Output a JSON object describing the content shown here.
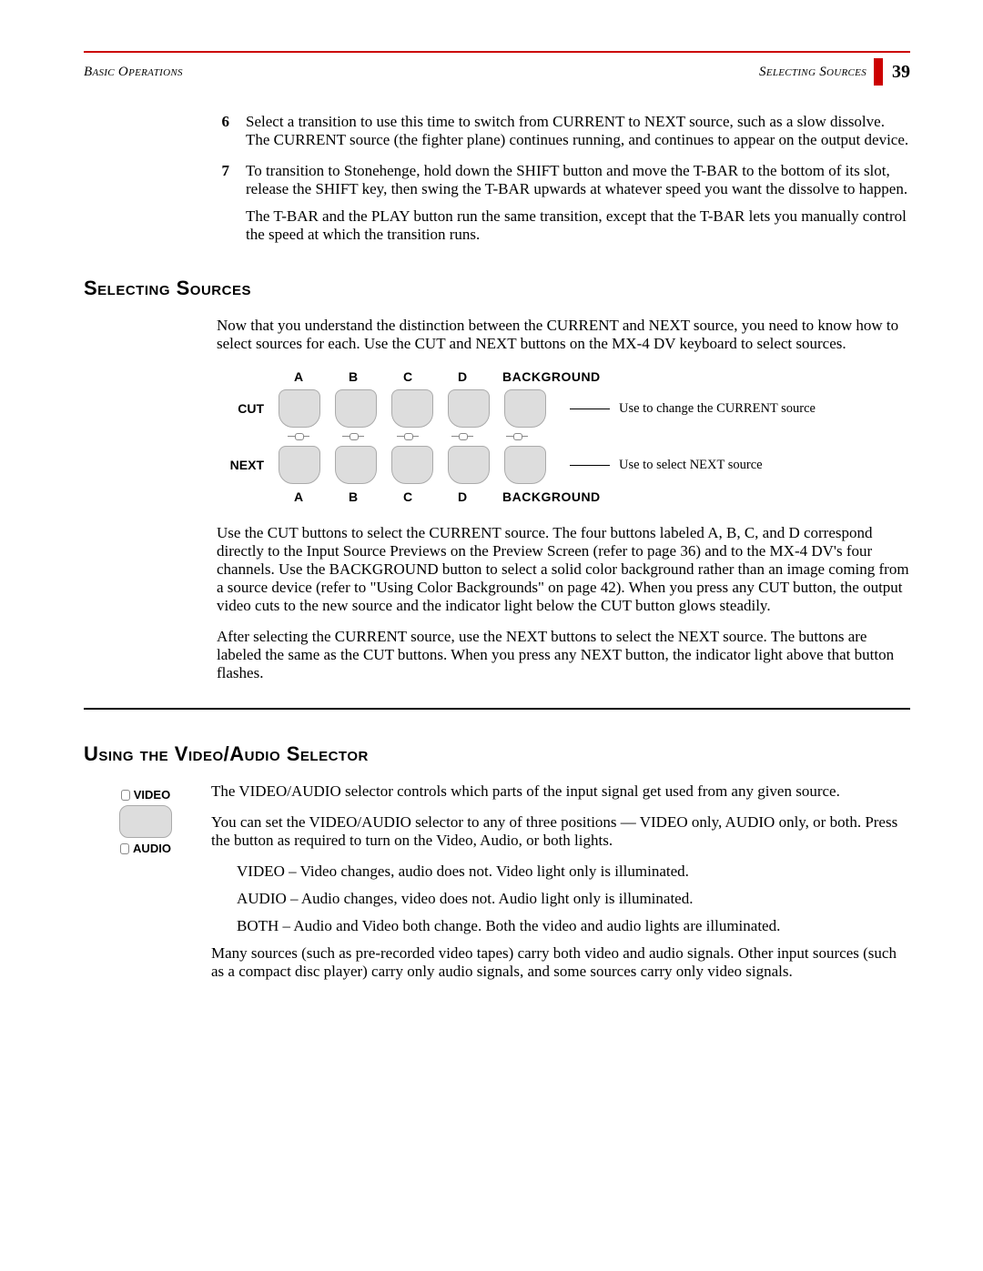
{
  "header": {
    "left": "Basic Operations",
    "right": "Selecting Sources",
    "page": "39"
  },
  "steps": [
    {
      "num": "6",
      "text": "Select a transition to use this time to switch from CURRENT to NEXT source, such as a slow dissolve. The CURRENT source (the fighter plane) continues running, and continues to appear on the output device."
    },
    {
      "num": "7",
      "text": "To transition to Stonehenge, hold down the SHIFT button and move the T-BAR to the bottom of its slot, release the SHIFT key, then swing the T-BAR upwards at whatever speed you want the dissolve to happen.",
      "after": "The T-BAR and the PLAY button run the same transition, except that the T-BAR lets you manually control the speed at which the transition runs."
    }
  ],
  "section1": {
    "heading": "Selecting Sources",
    "intro": "Now that you understand the distinction between the CURRENT and NEXT source, you need to know how to select sources for each. Use the CUT and NEXT buttons on the MX-4 DV keyboard to select sources.",
    "diagram": {
      "cols": [
        "A",
        "B",
        "C",
        "D"
      ],
      "bg": "BACKGROUND",
      "row1": "CUT",
      "row2": "NEXT",
      "annot1": "Use to change the CURRENT source",
      "annot2": "Use to select NEXT source"
    },
    "p1": "Use the CUT buttons to select the CURRENT source. The four buttons labeled A, B, C, and D correspond directly to the Input Source Previews on the Preview Screen (refer to page 36) and to the MX-4 DV's four channels. Use the BACKGROUND button to select a solid color background rather than an image coming from a source device (refer to \"Using Color Backgrounds\" on page 42). When you press any CUT button, the output video cuts to the new source and the indicator light below the CUT button glows steadily.",
    "p2": "After selecting the CURRENT source, use the NEXT buttons to select the NEXT source. The buttons are labeled the same as the CUT buttons. When you press any NEXT button, the indicator light above that button flashes."
  },
  "section2": {
    "heading": "Using the Video/Audio Selector",
    "fig": {
      "top": "VIDEO",
      "bottom": "AUDIO"
    },
    "p1": "The VIDEO/AUDIO selector controls which parts of the input signal get used from any given source.",
    "p2": "You can set the VIDEO/AUDIO selector to any of three positions — VIDEO only, AUDIO only, or both. Press the button as required to turn on the Video, Audio, or both lights.",
    "items": [
      "VIDEO – Video changes, audio does not. Video light only is illuminated.",
      "AUDIO – Audio changes, video does not. Audio light only is illuminated.",
      "BOTH – Audio and Video both change. Both the video and audio lights are illuminated."
    ],
    "p3": "Many sources (such as pre-recorded video tapes) carry both video and audio signals. Other input sources (such as a compact disc player) carry only audio signals, and some sources carry only video signals."
  }
}
